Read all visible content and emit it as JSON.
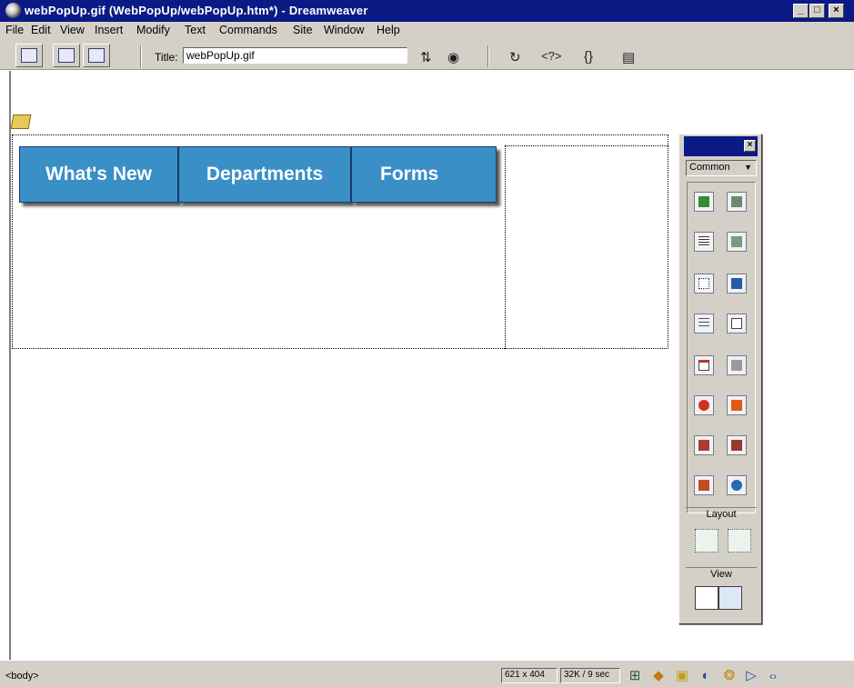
{
  "window": {
    "title": "webPopUp.gif (WebPopUp/webPopUp.htm*) - Dreamweaver",
    "minimize_icon": "minimize-icon",
    "maximize_icon": "maximize-icon",
    "close_icon": "close-icon"
  },
  "menu": {
    "items": [
      {
        "label": "File",
        "mnemonic": "F"
      },
      {
        "label": "Edit",
        "mnemonic": "E"
      },
      {
        "label": "View",
        "mnemonic": "V"
      },
      {
        "label": "Insert",
        "mnemonic": "I"
      },
      {
        "label": "Modify",
        "mnemonic": "M"
      },
      {
        "label": "Text",
        "mnemonic": "T"
      },
      {
        "label": "Commands",
        "mnemonic": "C"
      },
      {
        "label": "Site",
        "mnemonic": "S"
      },
      {
        "label": "Window",
        "mnemonic": "W"
      },
      {
        "label": "Help",
        "mnemonic": "H"
      }
    ]
  },
  "toolbar": {
    "view_buttons": [
      "code-view-icon",
      "split-view-icon",
      "design-view-icon"
    ],
    "title_label": "Title:",
    "title_value": "webPopUp.gif",
    "icons": [
      "file-management-icon",
      "preview-browser-icon",
      "refresh-icon",
      "reference-icon",
      "code-navigation-icon",
      "view-options-icon"
    ],
    "icon_glyphs": [
      "⇅",
      "◉",
      "↻",
      "<?>",
      "{}",
      "▤"
    ]
  },
  "document": {
    "nav_tabs": [
      {
        "label": "What's New"
      },
      {
        "label": "Departments"
      },
      {
        "label": "Forms"
      }
    ],
    "nav_color": "#3a8fc7"
  },
  "objects_panel": {
    "category": "Common",
    "layout_label": "Layout",
    "view_label": "View",
    "common_icons": [
      "insert-image-icon",
      "insert-rollover-image-icon",
      "insert-table-icon",
      "insert-tabular-data-icon",
      "draw-layer-icon",
      "insert-navigation-bar-icon",
      "insert-horizontal-rule-icon",
      "insert-email-link-icon",
      "insert-date-icon",
      "insert-server-side-include-icon",
      "insert-fireworks-html-icon",
      "insert-flash-icon",
      "insert-flash-button-icon",
      "insert-flash-text-icon",
      "insert-shockwave-icon",
      "insert-generator-icon"
    ],
    "layout_icons": [
      "draw-layout-cell-icon",
      "draw-layout-table-icon"
    ],
    "view_icons": [
      "standard-view-icon",
      "layout-view-icon"
    ]
  },
  "status": {
    "tag": "<body>",
    "window_size": "621 x 404",
    "download_stats": "32K / 9 sec",
    "launcher_icons": [
      "site-icon",
      "assets-icon",
      "html-styles-icon",
      "css-styles-icon",
      "behaviors-icon",
      "timelines-icon",
      "code-inspector-icon"
    ],
    "launcher_glyphs": [
      "⊞",
      "◆",
      "▣",
      "◐",
      "❂",
      "▷",
      "‹›"
    ]
  }
}
